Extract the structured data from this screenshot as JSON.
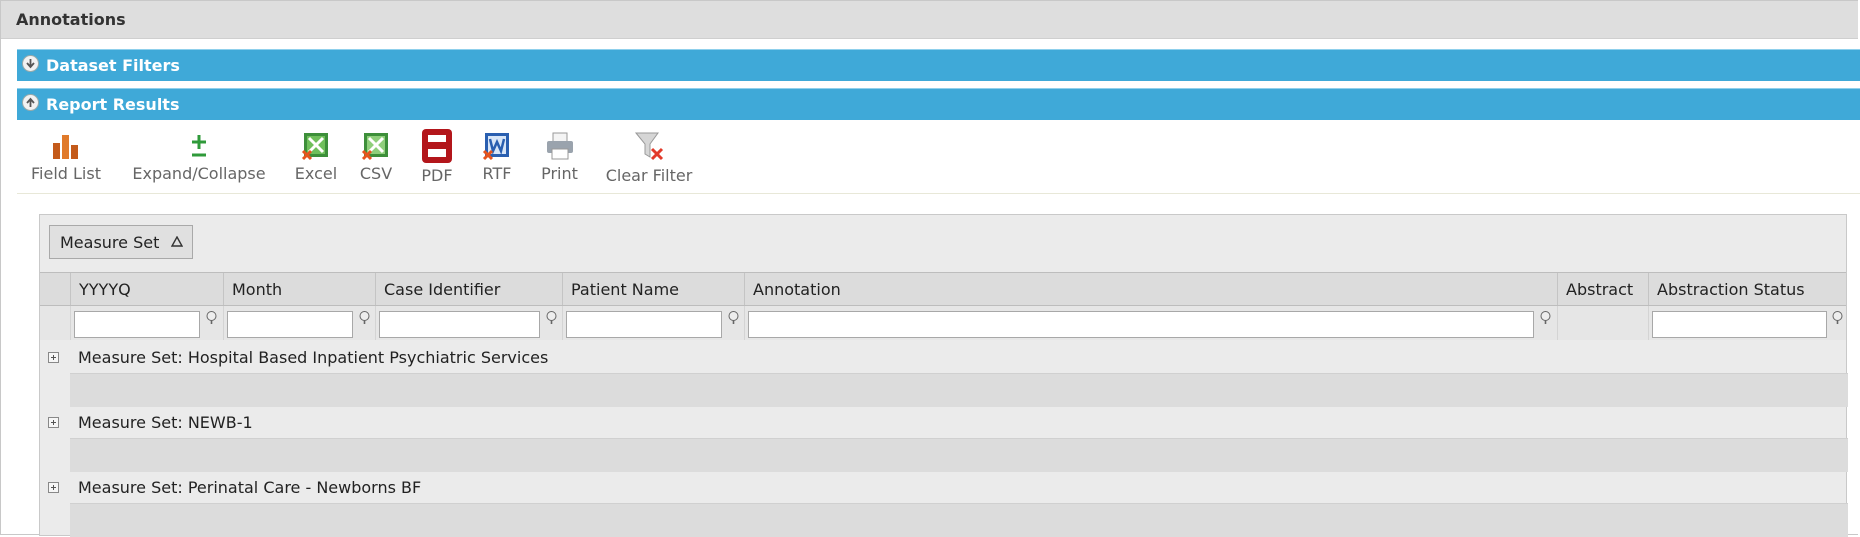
{
  "panel": {
    "title": "Annotations"
  },
  "sections": {
    "dataset_filters": {
      "label": "Dataset Filters",
      "state": "collapsed"
    },
    "report_results": {
      "label": "Report Results",
      "state": "expanded"
    }
  },
  "toolbar": {
    "field_list": "Field List",
    "expand_collapse": "Expand/Collapse",
    "excel": "Excel",
    "csv": "CSV",
    "pdf": "PDF",
    "rtf": "RTF",
    "print": "Print",
    "clear_filter": "Clear Filter"
  },
  "grid": {
    "group_by": {
      "label": "Measure Set",
      "sort": "ascending"
    },
    "columns": [
      "YYYYQ",
      "Month",
      "Case Identifier",
      "Patient Name",
      "Annotation",
      "Abstract",
      "Abstraction Status"
    ],
    "filters": {
      "yyyyq": "",
      "month": "",
      "case_identifier": "",
      "patient_name": "",
      "annotation": "",
      "abstraction_status": ""
    },
    "groups": [
      {
        "label": "Measure Set: Hospital Based Inpatient Psychiatric Services"
      },
      {
        "label": "Measure Set: NEWB-1"
      },
      {
        "label": "Measure Set: Perinatal Care - Newborns BF"
      }
    ]
  },
  "colors": {
    "section_bar": "#3fa9d8",
    "title_bar": "#dedede",
    "grid_bg": "#ebebeb"
  },
  "icons": [
    "field-list-icon",
    "expand-collapse-icon",
    "excel-icon",
    "csv-icon",
    "pdf-icon",
    "rtf-icon",
    "print-icon",
    "clear-filter-icon",
    "filter-icon",
    "expand-plus-icon"
  ]
}
